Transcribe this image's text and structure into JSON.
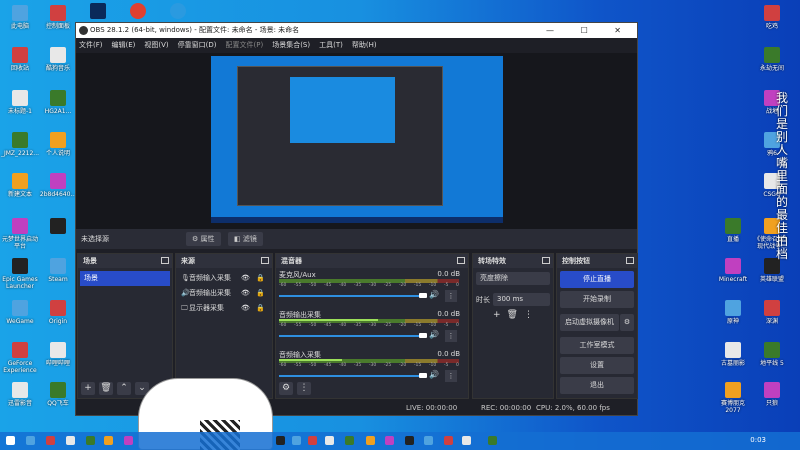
{
  "desktop": {
    "left_icons": [
      [
        "此电脑",
        "控制面板"
      ],
      [
        "回收站",
        "酷狗音乐"
      ],
      [
        "未标题-1",
        "HG2A1..."
      ],
      [
        "_JMZ_2212...",
        "个人说明"
      ],
      [
        "新建文本",
        "2b8d4640..."
      ],
      [
        "元梦世界启动平台",
        ""
      ],
      [
        "Epic Games Launcher",
        "Steam"
      ],
      [
        "WeGame",
        "Origin"
      ],
      [
        "GeForce Experience",
        "哔哩哔哩"
      ],
      [
        "迅雷影音",
        "QQ飞车"
      ]
    ],
    "top_icons": [
      "Photoshop",
      "Chrome",
      "Edge"
    ],
    "right_icons": [
      [
        "",
        "吃鸡"
      ],
      [
        "",
        "永劫无间"
      ],
      [
        "",
        "战地"
      ],
      [
        "",
        "鸦6"
      ],
      [
        "",
        "CSGO"
      ],
      [
        "直播",
        "《使命召唤》现代战争..."
      ],
      [
        "Minecraft",
        "英雄联盟"
      ],
      [
        "原神",
        "深渊"
      ],
      [
        "古墓丽影",
        "地平线 5"
      ],
      [
        "赛博朋克 2077",
        "只狼"
      ]
    ],
    "vertical_text": "我们是别人嘴里面的最佳拍档"
  },
  "obs": {
    "title": "OBS 28.1.2 (64-bit, windows) - 配置文件: 未命名 - 场景: 未命名",
    "window_buttons": "— ☐ ✕",
    "menu": [
      "文件(F)",
      "编辑(E)",
      "视图(V)",
      "停靠窗口(D)",
      "配置文件(P)",
      "场景集合(S)",
      "工具(T)",
      "帮助(H)"
    ],
    "source_bar": {
      "label": "未选择源",
      "properties": "⚙ 属性",
      "filters": "◧ 滤镜"
    },
    "scenes": {
      "title": "场景",
      "items": [
        "场景"
      ]
    },
    "sources": {
      "title": "来源",
      "items": [
        {
          "icon": "🎙",
          "label": "音频输入采集"
        },
        {
          "icon": "🔊",
          "label": "音频输出采集"
        },
        {
          "icon": "🖵",
          "label": "显示器采集"
        }
      ]
    },
    "mixer": {
      "title": "混音器",
      "ticks": [
        "-60",
        "-55",
        "-50",
        "-45",
        "-40",
        "-35",
        "-30",
        "-25",
        "-20",
        "-15",
        "-10",
        "-5",
        "0"
      ],
      "channels": [
        {
          "name": "麦克风/Aux",
          "db": "0.0 dB",
          "level": 0
        },
        {
          "name": "音频输出采集",
          "db": "0.0 dB",
          "level": 0.55
        },
        {
          "name": "音频输入采集",
          "db": "0.0 dB",
          "level": 0.35
        }
      ]
    },
    "transitions": {
      "title": "转场特效",
      "selected": "亮度擦除",
      "duration_label": "时长",
      "duration": "300 ms"
    },
    "controls": {
      "title": "控制按钮",
      "buttons": [
        "停止直播",
        "开始录制",
        "启动虚拟摄像机",
        "工作室模式",
        "设置",
        "退出"
      ]
    },
    "status": {
      "live": "LIVE: 00:00:00",
      "rec": "REC: 00:00:00",
      "cpu": "CPU: 2.0%, 60.00 fps"
    }
  },
  "taskbar": {
    "time": "0:03"
  }
}
